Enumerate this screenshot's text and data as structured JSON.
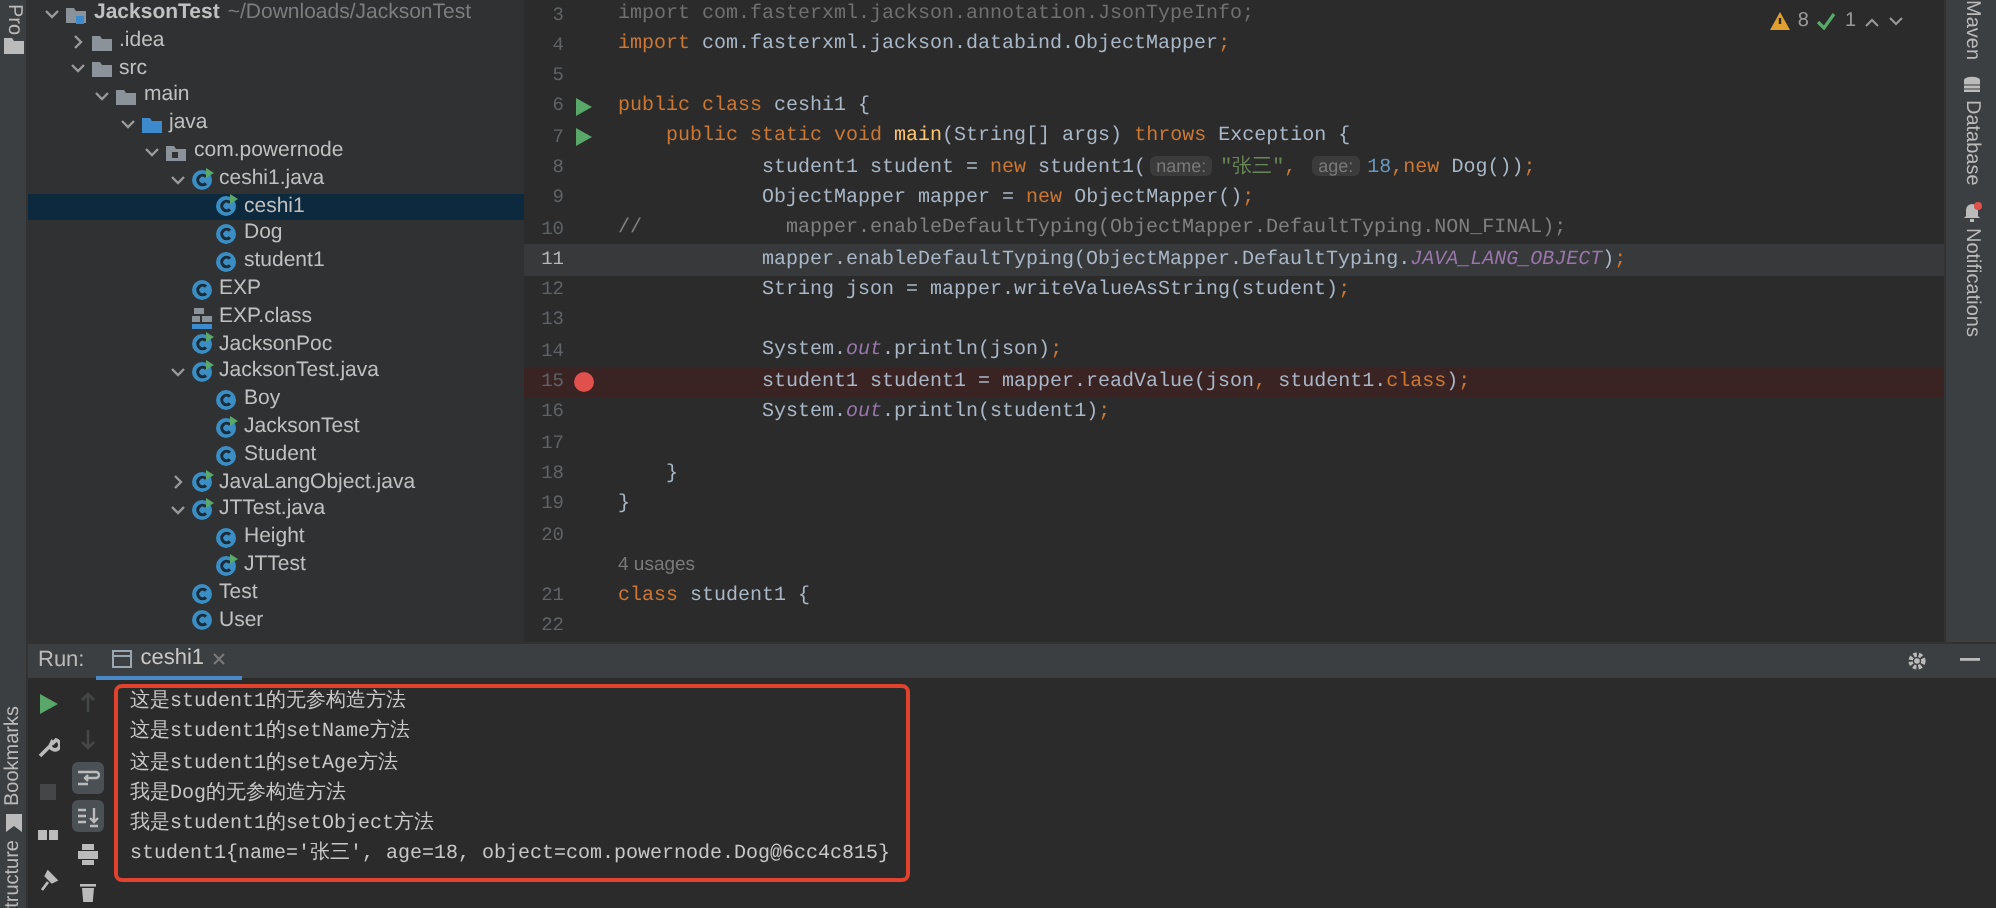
{
  "left_strip": {
    "project_tab": "Pro",
    "bookmarks_tab": "Bookmarks",
    "structure_tab": "tructure"
  },
  "project_tree": [
    {
      "label": "JacksonTest",
      "path": "~/Downloads/JacksonTest",
      "kind": "project",
      "expanded": true,
      "selected": false,
      "children": [
        {
          "label": ".idea",
          "kind": "folder",
          "expanded": false,
          "selected": false
        },
        {
          "label": "src",
          "kind": "folder",
          "expanded": true,
          "selected": false,
          "children": [
            {
              "label": "main",
              "kind": "folder",
              "expanded": true,
              "selected": false,
              "children": [
                {
                  "label": "java",
                  "kind": "source-folder",
                  "expanded": true,
                  "selected": false,
                  "children": [
                    {
                      "label": "com.powernode",
                      "kind": "package",
                      "expanded": true,
                      "selected": false,
                      "children": [
                        {
                          "label": "ceshi1.java",
                          "kind": "class-run",
                          "expanded": true,
                          "selected": false,
                          "children": [
                            {
                              "label": "ceshi1",
                              "kind": "class-run",
                              "selected": true
                            },
                            {
                              "label": "Dog",
                              "kind": "class",
                              "selected": false
                            },
                            {
                              "label": "student1",
                              "kind": "class",
                              "selected": false
                            }
                          ]
                        },
                        {
                          "label": "EXP",
                          "kind": "class",
                          "selected": false
                        },
                        {
                          "label": "EXP.class",
                          "kind": "binary",
                          "selected": false
                        },
                        {
                          "label": "JacksonPoc",
                          "kind": "class-run",
                          "selected": false
                        },
                        {
                          "label": "JacksonTest.java",
                          "kind": "class-run",
                          "expanded": true,
                          "selected": false,
                          "children": [
                            {
                              "label": "Boy",
                              "kind": "class",
                              "selected": false
                            },
                            {
                              "label": "JacksonTest",
                              "kind": "class-run",
                              "selected": false
                            },
                            {
                              "label": "Student",
                              "kind": "class",
                              "selected": false
                            }
                          ]
                        },
                        {
                          "label": "JavaLangObject.java",
                          "kind": "class-run",
                          "expanded": false,
                          "selected": false
                        },
                        {
                          "label": "JTTest.java",
                          "kind": "class-run",
                          "expanded": true,
                          "selected": false,
                          "children": [
                            {
                              "label": "Height",
                              "kind": "class",
                              "selected": false
                            },
                            {
                              "label": "JTTest",
                              "kind": "class-run",
                              "selected": false
                            }
                          ]
                        },
                        {
                          "label": "Test",
                          "kind": "class",
                          "selected": false
                        },
                        {
                          "label": "User",
                          "kind": "class",
                          "selected": false
                        }
                      ]
                    }
                  ]
                }
              ]
            }
          ]
        }
      ]
    }
  ],
  "editor": {
    "inspections": {
      "warnings": "8",
      "ok": "1"
    },
    "lines": [
      {
        "kind": "code",
        "number": "3",
        "run": false,
        "breakpoint": false,
        "current": false,
        "tokens": [
          {
            "kind": "unused",
            "text": "import com.fasterxml.jackson.annotation.JsonTypeInfo;"
          }
        ]
      },
      {
        "kind": "code",
        "number": "4",
        "run": false,
        "breakpoint": false,
        "current": false,
        "tokens": [
          {
            "kind": "kw",
            "text": "import"
          },
          {
            "kind": "plain",
            "text": " com.fasterxml.jackson.databind.ObjectMapper"
          },
          {
            "kind": "kw",
            "text": ";"
          }
        ]
      },
      {
        "kind": "code",
        "number": "5",
        "run": false,
        "breakpoint": false,
        "current": false
      },
      {
        "kind": "code",
        "number": "6",
        "run": true,
        "breakpoint": false,
        "current": false,
        "tokens": [
          {
            "kind": "kw",
            "text": "public class "
          },
          {
            "kind": "plain",
            "text": "ceshi1 {"
          }
        ]
      },
      {
        "kind": "code",
        "number": "7",
        "run": true,
        "breakpoint": false,
        "current": false,
        "tokens": [
          {
            "kind": "kw",
            "text": "    public static void "
          },
          {
            "kind": "method",
            "text": "main"
          },
          {
            "kind": "plain",
            "text": "(String[] args) "
          },
          {
            "kind": "kw",
            "text": "throws "
          },
          {
            "kind": "plain",
            "text": "Exception {"
          }
        ]
      },
      {
        "kind": "code",
        "number": "8",
        "run": false,
        "breakpoint": false,
        "current": false,
        "tokens": [
          {
            "kind": "plain",
            "text": "            student1 student = "
          },
          {
            "kind": "kw",
            "text": "new "
          },
          {
            "kind": "plain",
            "text": "student1("
          },
          {
            "kind": "hint",
            "text": "name:"
          },
          {
            "kind": "str",
            "text": "\"张三\""
          },
          {
            "kind": "kw",
            "text": ", "
          },
          {
            "kind": "hint",
            "text": "age:"
          },
          {
            "kind": "num",
            "text": "18"
          },
          {
            "kind": "kw",
            "text": ","
          },
          {
            "kind": "kw",
            "text": "new "
          },
          {
            "kind": "plain",
            "text": "Dog())"
          },
          {
            "kind": "kw",
            "text": ";"
          }
        ]
      },
      {
        "kind": "code",
        "number": "9",
        "run": false,
        "breakpoint": false,
        "current": false,
        "tokens": [
          {
            "kind": "plain",
            "text": "            ObjectMapper mapper = "
          },
          {
            "kind": "kw",
            "text": "new "
          },
          {
            "kind": "plain",
            "text": "ObjectMapper()"
          },
          {
            "kind": "kw",
            "text": ";"
          }
        ]
      },
      {
        "kind": "code",
        "number": "10",
        "run": false,
        "breakpoint": false,
        "current": false,
        "tokens": [
          {
            "kind": "comment",
            "text": "//            mapper.enableDefaultTyping(ObjectMapper.DefaultTyping.NON_FINAL);"
          }
        ]
      },
      {
        "kind": "code",
        "number": "11",
        "run": false,
        "breakpoint": false,
        "current": true,
        "tokens": [
          {
            "kind": "plain",
            "text": "            mapper.enableDefaultTyping(ObjectMapper.DefaultTyping."
          },
          {
            "kind": "field",
            "text": "JAVA_LANG_OBJECT"
          },
          {
            "kind": "plain",
            "text": ")"
          },
          {
            "kind": "kw",
            "text": ";"
          }
        ]
      },
      {
        "kind": "code",
        "number": "12",
        "run": false,
        "breakpoint": false,
        "current": false,
        "tokens": [
          {
            "kind": "plain",
            "text": "            String json = mapper.writeValueAsString(student)"
          },
          {
            "kind": "kw",
            "text": ";"
          }
        ]
      },
      {
        "kind": "code",
        "number": "13",
        "run": false,
        "breakpoint": false,
        "current": false
      },
      {
        "kind": "code",
        "number": "14",
        "run": false,
        "breakpoint": false,
        "current": false,
        "tokens": [
          {
            "kind": "plain",
            "text": "            System."
          },
          {
            "kind": "field",
            "text": "out"
          },
          {
            "kind": "plain",
            "text": ".println(json)"
          },
          {
            "kind": "kw",
            "text": ";"
          }
        ]
      },
      {
        "kind": "code",
        "number": "15",
        "run": false,
        "breakpoint": true,
        "current": false,
        "tokens": [
          {
            "kind": "plain",
            "text": "            student1 student1 = mapper.readValue(json"
          },
          {
            "kind": "kw",
            "text": ", "
          },
          {
            "kind": "plain",
            "text": "student1."
          },
          {
            "kind": "kw",
            "text": "class"
          },
          {
            "kind": "plain",
            "text": ")"
          },
          {
            "kind": "kw",
            "text": ";"
          }
        ]
      },
      {
        "kind": "code",
        "number": "16",
        "run": false,
        "breakpoint": false,
        "current": false,
        "tokens": [
          {
            "kind": "plain",
            "text": "            System."
          },
          {
            "kind": "field",
            "text": "out"
          },
          {
            "kind": "plain",
            "text": ".println(student1)"
          },
          {
            "kind": "kw",
            "text": ";"
          }
        ]
      },
      {
        "kind": "code",
        "number": "17",
        "run": false,
        "breakpoint": false,
        "current": false
      },
      {
        "kind": "code",
        "number": "18",
        "run": false,
        "breakpoint": false,
        "current": false,
        "tokens": [
          {
            "kind": "plain",
            "text": "    }"
          }
        ]
      },
      {
        "kind": "code",
        "number": "19",
        "run": false,
        "breakpoint": false,
        "current": false,
        "tokens": [
          {
            "kind": "plain",
            "text": "}"
          }
        ]
      },
      {
        "kind": "code",
        "number": "20",
        "run": false,
        "breakpoint": false,
        "current": false
      },
      {
        "kind": "usages",
        "text": "4 usages"
      },
      {
        "kind": "code",
        "number": "21",
        "run": false,
        "breakpoint": false,
        "current": false,
        "tokens": [
          {
            "kind": "kw",
            "text": "class "
          },
          {
            "kind": "plain",
            "text": "student1 {"
          }
        ]
      },
      {
        "kind": "code",
        "number": "22",
        "run": false,
        "breakpoint": false,
        "current": false
      }
    ]
  },
  "right_strip": {
    "maven_tab": "Maven",
    "database_tab": "Database",
    "notifications_tab": "Notifications",
    "notifications_unread": true
  },
  "run_panel": {
    "label": "Run:",
    "tabs": [
      {
        "label": "ceshi1",
        "selected": true
      }
    ],
    "run_toolbar": [
      {
        "kind": "run",
        "disabled": false
      },
      {
        "kind": "wrench",
        "disabled": false
      },
      {
        "kind": "stop",
        "disabled": true
      },
      {
        "kind": "layout",
        "disabled": false
      },
      {
        "kind": "pin",
        "disabled": false
      }
    ],
    "console_toolbar": [
      {
        "kind": "up",
        "disabled": true,
        "on": false
      },
      {
        "kind": "down",
        "disabled": true,
        "on": false
      },
      {
        "kind": "wrap",
        "disabled": false,
        "on": true
      },
      {
        "kind": "scroll-end",
        "disabled": false,
        "on": true
      },
      {
        "kind": "print",
        "disabled": false,
        "on": false
      },
      {
        "kind": "trash",
        "disabled": false,
        "on": false
      }
    ],
    "console": {
      "annotated": true,
      "lines": [
        "这是student1的无参构造方法",
        "这是student1的setName方法",
        "这是student1的setAge方法",
        "我是Dog的无参构造方法",
        "我是student1的setObject方法",
        "student1{name='张三', age=18, object=com.powernode.Dog@6cc4c815}"
      ]
    }
  }
}
